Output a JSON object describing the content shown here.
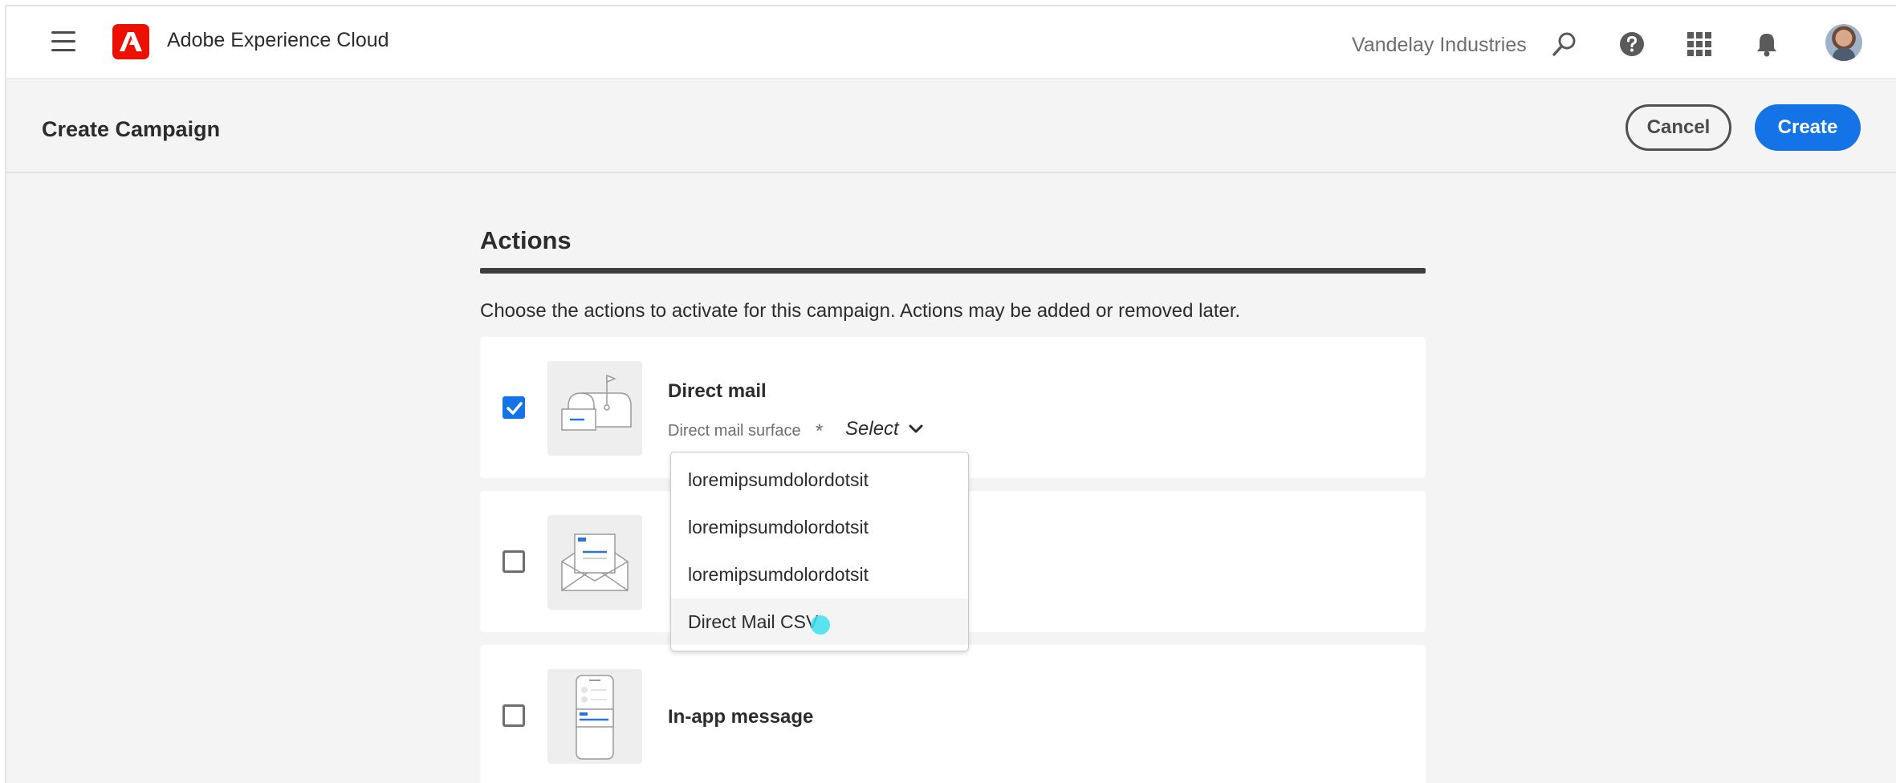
{
  "nav": {
    "app_title": "Adobe Experience Cloud",
    "org_name": "Vandelay Industries",
    "icons": [
      "menu-icon",
      "adobe-logo",
      "search-icon",
      "help-icon",
      "apps-grid-icon",
      "bell-icon",
      "avatar"
    ]
  },
  "header": {
    "title": "Create Campaign",
    "cancel_label": "Cancel",
    "create_label": "Create"
  },
  "actions": {
    "title": "Actions",
    "description": "Choose the actions to activate for this campaign. Actions may be added or removed later.",
    "items": [
      {
        "name": "Direct mail",
        "checked": true,
        "field_label": "Direct mail surface",
        "required_mark": "*",
        "select_label": "Select"
      },
      {
        "name": "",
        "checked": false
      },
      {
        "name": "In-app message",
        "checked": false
      }
    ]
  },
  "dropdown": {
    "options": [
      "loremipsumdolordotsit",
      "loremipsumdolordotsit",
      "loremipsumdolordotsit",
      "Direct Mail CSV"
    ],
    "hovered_index": 3
  },
  "colors": {
    "accent": "#1473e6",
    "adobe_red": "#eb1000",
    "page_bg": "#f4f4f4"
  }
}
